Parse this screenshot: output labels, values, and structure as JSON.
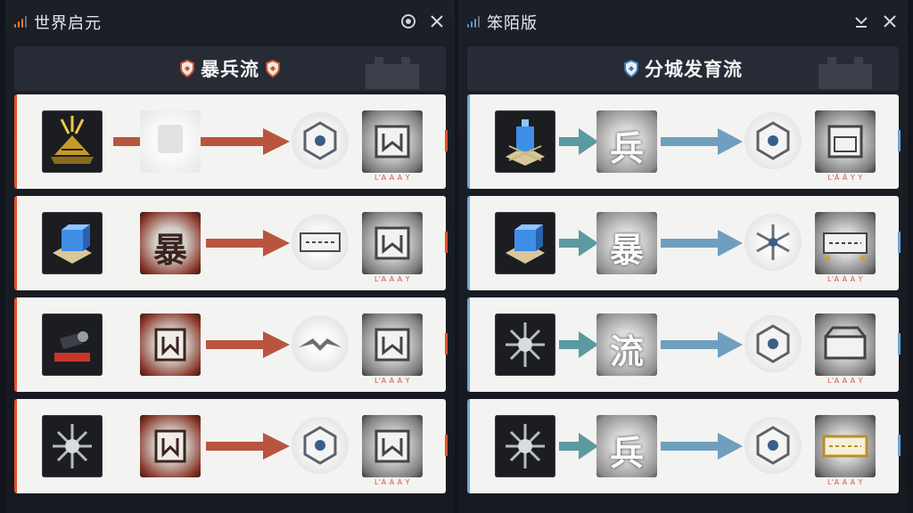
{
  "colors": {
    "bg": "#12151b",
    "panel": "#1b1f27",
    "header": "#262b35",
    "row": "#f3f3f1",
    "red_arrow": "#b9553e",
    "teal_arrow": "#5b9aa0",
    "blue_arrow": "#6f9fbf",
    "red_accent": "#e5532d",
    "blue_accent": "#6aa8d8"
  },
  "left": {
    "window_title": "世界启元",
    "title_icons": [
      "signal-bars-icon",
      "target-icon",
      "close-icon"
    ],
    "header_title": "暴兵流",
    "header_icons": [
      "shield-icon",
      "shield-icon"
    ],
    "rows": [
      {
        "items": [
          "gold-pyramid-icon",
          "ghost-card-icon",
          "hexagon-crest-icon",
          "fortress-icon"
        ],
        "glyph": "",
        "captions": [
          "",
          "",
          "",
          "L'A A A Y"
        ]
      },
      {
        "items": [
          "blue-crystal-icon",
          "bao-glyph-card",
          "scroll-banner-icon",
          "fortress-icon"
        ],
        "glyph": "暴",
        "captions": [
          "",
          "",
          "",
          "L'A A A Y"
        ]
      },
      {
        "items": [
          "red-cannon-icon",
          "fortress-card-icon",
          "winged-emblem-icon",
          "fortress-icon"
        ],
        "glyph": "",
        "captions": [
          "",
          "",
          "",
          "L'A A A Y"
        ]
      },
      {
        "items": [
          "silver-star-icon",
          "fortress-card-icon",
          "hexagon-crest-icon",
          "fortress-icon"
        ],
        "glyph": "",
        "captions": [
          "",
          "",
          "",
          "L'A A A Y"
        ]
      }
    ]
  },
  "right": {
    "window_title": "笨陌版",
    "title_icons": [
      "signal-bars-icon",
      "minimize-icon",
      "close-icon"
    ],
    "header_title": "分城发育流",
    "header_icons": [
      "shield-icon"
    ],
    "rows": [
      {
        "items": [
          "blue-tower-icon",
          "bing-glyph-card",
          "hexagon-crest-icon",
          "fortress-icon"
        ],
        "glyph": "兵",
        "captions": [
          "",
          "",
          "",
          "L'Ä Ä Y Y"
        ]
      },
      {
        "items": [
          "blue-crystal-icon",
          "bao-glyph-card",
          "snowflake-crest-icon",
          "scroll-banner-icon"
        ],
        "glyph": "暴",
        "captions": [
          "",
          "",
          "",
          "L'A A A Y"
        ]
      },
      {
        "items": [
          "silver-star-icon",
          "liu-glyph-card",
          "hexagon-crest-icon",
          "treasure-icon"
        ],
        "glyph": "流",
        "captions": [
          "",
          "",
          "",
          "L'A A A Y"
        ]
      },
      {
        "items": [
          "silver-star-icon",
          "bing-glyph-card",
          "hexagon-crest-icon",
          "gold-scroll-icon"
        ],
        "glyph": "兵",
        "captions": [
          "",
          "",
          "",
          "L'A A A Y"
        ]
      }
    ]
  }
}
